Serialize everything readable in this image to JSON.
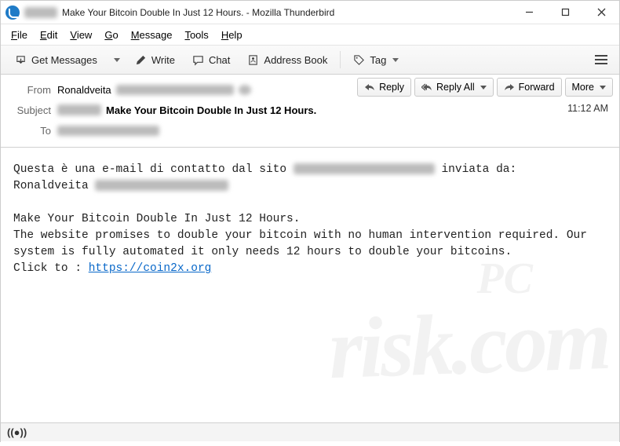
{
  "window": {
    "title": "Make Your Bitcoin Double In Just 12 Hours. - Mozilla Thunderbird"
  },
  "menu": {
    "file": "File",
    "edit": "Edit",
    "view": "View",
    "go": "Go",
    "message": "Message",
    "tools": "Tools",
    "help": "Help"
  },
  "toolbar": {
    "get_messages": "Get Messages",
    "write": "Write",
    "chat": "Chat",
    "address_book": "Address Book",
    "tag": "Tag"
  },
  "headers": {
    "from_label": "From",
    "from_value": "Ronaldveita",
    "subject_label": "Subject",
    "subject_value": "Make Your Bitcoin Double In Just 12 Hours.",
    "to_label": "To",
    "time": "11:12 AM"
  },
  "actions": {
    "reply": "Reply",
    "reply_all": "Reply All",
    "forward": "Forward",
    "more": "More"
  },
  "body": {
    "line1a": "Questa è una e-mail di contatto dal sito ",
    "line1b": " inviata da:",
    "line2": "Ronaldveita ",
    "para2_l1": "Make Your Bitcoin Double In Just 12 Hours.",
    "para2_l2": "The website promises to double your bitcoin with no human intervention required. Our system is fully automated it only needs 12 hours to double your bitcoins.",
    "clickto": "Click to : ",
    "link": "https://coin2x.org"
  },
  "watermark": {
    "small": "PC",
    "big": "risk.com"
  }
}
